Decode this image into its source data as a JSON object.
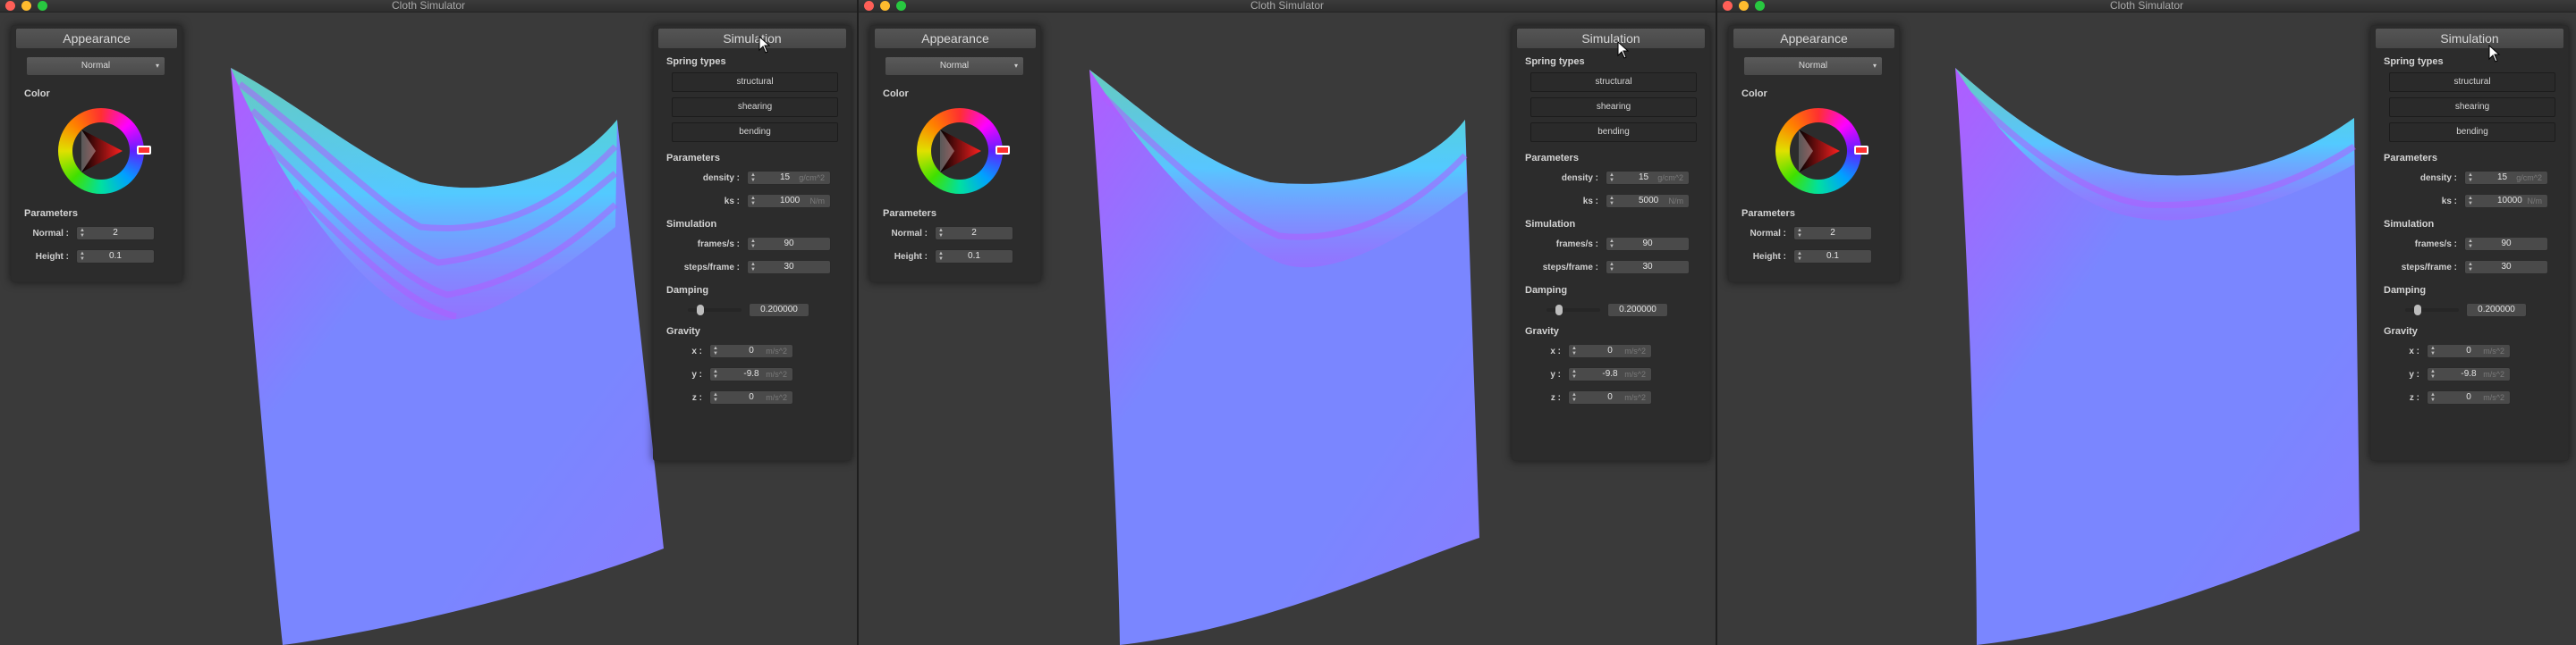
{
  "windows": [
    {
      "title": "Cloth Simulator",
      "appearance": {
        "header": "Appearance",
        "shading_mode": "Normal",
        "color_title": "Color",
        "params_title": "Parameters",
        "normal_label": "Normal :",
        "normal_value": "2",
        "height_label": "Height :",
        "height_value": "0.1"
      },
      "simulation": {
        "header": "Simulation",
        "spring_types_title": "Spring types",
        "spring_structural": "structural",
        "spring_shearing": "shearing",
        "spring_bending": "bending",
        "params_title": "Parameters",
        "density_label": "density :",
        "density_value": "15",
        "density_unit": "g/cm^2",
        "ks_label": "ks :",
        "ks_value": "1000",
        "ks_unit": "N/m",
        "sim_title": "Simulation",
        "fps_label": "frames/s :",
        "fps_value": "90",
        "steps_label": "steps/frame :",
        "steps_value": "30",
        "damping_title": "Damping",
        "damping_value": "0.200000",
        "damping_level": 0.2,
        "gravity_title": "Gravity",
        "gx_label": "x :",
        "gx_value": "0",
        "gy_label": "y :",
        "gy_value": "-9.8",
        "gz_label": "z :",
        "gz_value": "0",
        "gravity_unit": "m/s^2"
      }
    },
    {
      "title": "Cloth Simulator",
      "appearance": {
        "header": "Appearance",
        "shading_mode": "Normal",
        "color_title": "Color",
        "params_title": "Parameters",
        "normal_label": "Normal :",
        "normal_value": "2",
        "height_label": "Height :",
        "height_value": "0.1"
      },
      "simulation": {
        "header": "Simulation",
        "spring_types_title": "Spring types",
        "spring_structural": "structural",
        "spring_shearing": "shearing",
        "spring_bending": "bending",
        "params_title": "Parameters",
        "density_label": "density :",
        "density_value": "15",
        "density_unit": "g/cm^2",
        "ks_label": "ks :",
        "ks_value": "5000",
        "ks_unit": "N/m",
        "sim_title": "Simulation",
        "fps_label": "frames/s :",
        "fps_value": "90",
        "steps_label": "steps/frame :",
        "steps_value": "30",
        "damping_title": "Damping",
        "damping_value": "0.200000",
        "damping_level": 0.2,
        "gravity_title": "Gravity",
        "gx_label": "x :",
        "gx_value": "0",
        "gy_label": "y :",
        "gy_value": "-9.8",
        "gz_label": "z :",
        "gz_value": "0",
        "gravity_unit": "m/s^2"
      }
    },
    {
      "title": "Cloth Simulator",
      "appearance": {
        "header": "Appearance",
        "shading_mode": "Normal",
        "color_title": "Color",
        "params_title": "Parameters",
        "normal_label": "Normal :",
        "normal_value": "2",
        "height_label": "Height :",
        "height_value": "0.1"
      },
      "simulation": {
        "header": "Simulation",
        "spring_types_title": "Spring types",
        "spring_structural": "structural",
        "spring_shearing": "shearing",
        "spring_bending": "bending",
        "params_title": "Parameters",
        "density_label": "density :",
        "density_value": "15",
        "density_unit": "g/cm^2",
        "ks_label": "ks :",
        "ks_value": "10000",
        "ks_unit": "N/m",
        "sim_title": "Simulation",
        "fps_label": "frames/s :",
        "fps_value": "90",
        "steps_label": "steps/frame :",
        "steps_value": "30",
        "damping_title": "Damping",
        "damping_value": "0.200000",
        "damping_level": 0.2,
        "gravity_title": "Gravity",
        "gx_label": "x :",
        "gx_value": "0",
        "gy_label": "y :",
        "gy_value": "-9.8",
        "gz_label": "z :",
        "gz_value": "0",
        "gravity_unit": "m/s^2"
      }
    }
  ],
  "colors": {
    "background": "#3a3a3a",
    "panel": "#2c2c2c",
    "cloth_blue": "#7a86ff",
    "cloth_cyan": "#46e0ff",
    "cloth_magenta": "#b05cff",
    "cloth_green": "#4cf0a8"
  }
}
